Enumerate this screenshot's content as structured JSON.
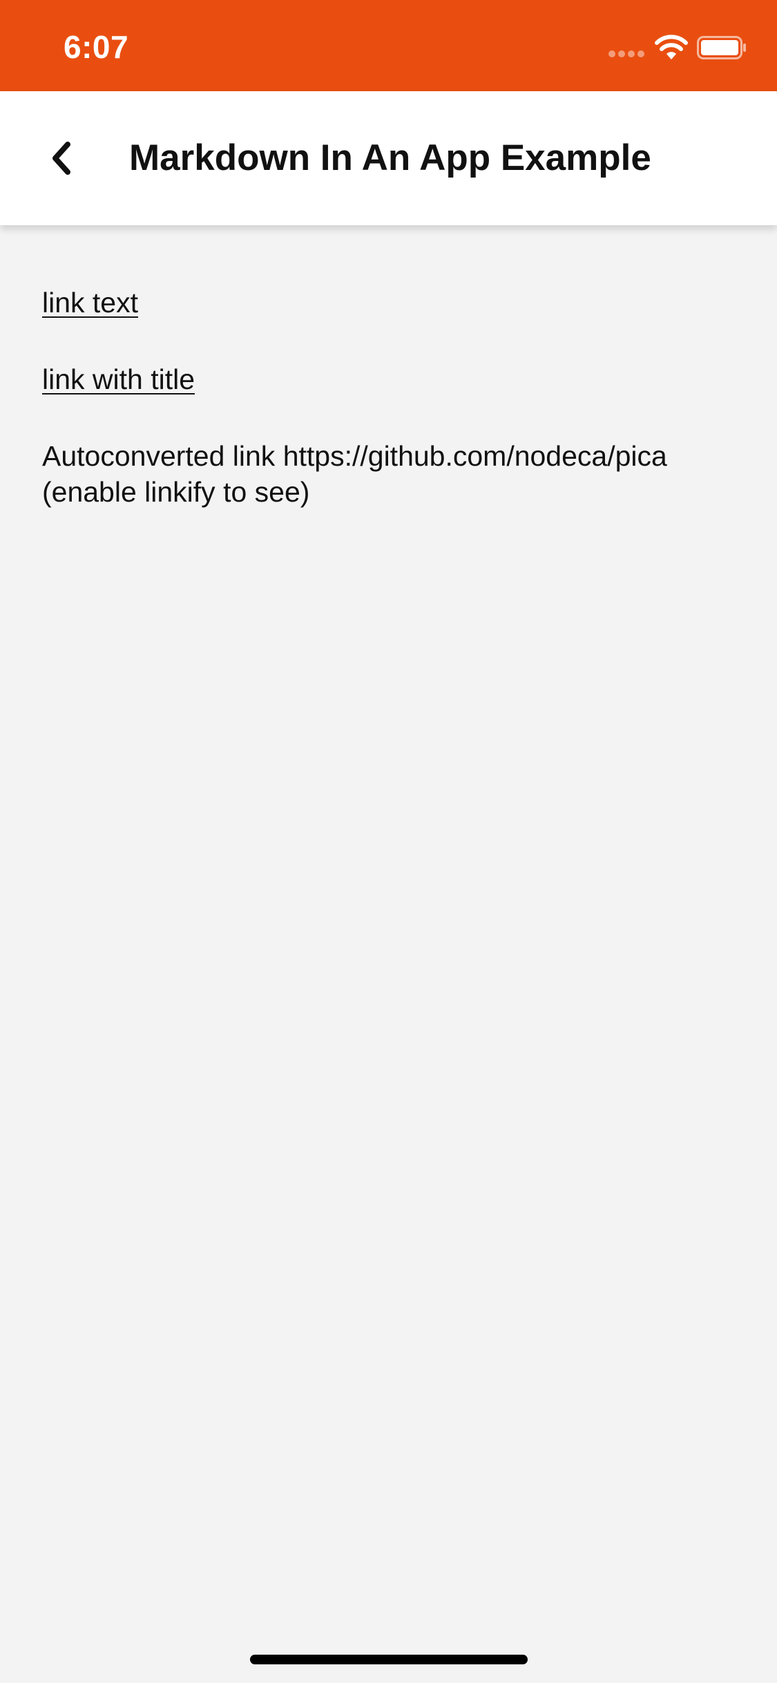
{
  "status_bar": {
    "time": "6:07",
    "background_color": "#e94e10",
    "icons": [
      "signal-icon",
      "wifi-icon",
      "battery-icon"
    ]
  },
  "nav": {
    "back_icon": "chevron-left-icon",
    "title": "Markdown In An App Example"
  },
  "content": {
    "link_text": "link text",
    "link_with_title": "link with title",
    "autoconverted_line": "Autoconverted link https://github.com/nodeca/pica\n(enable linkify to see)"
  },
  "colors": {
    "accent": "#e94e10",
    "background": "#f3f3f3",
    "text": "#111111"
  }
}
